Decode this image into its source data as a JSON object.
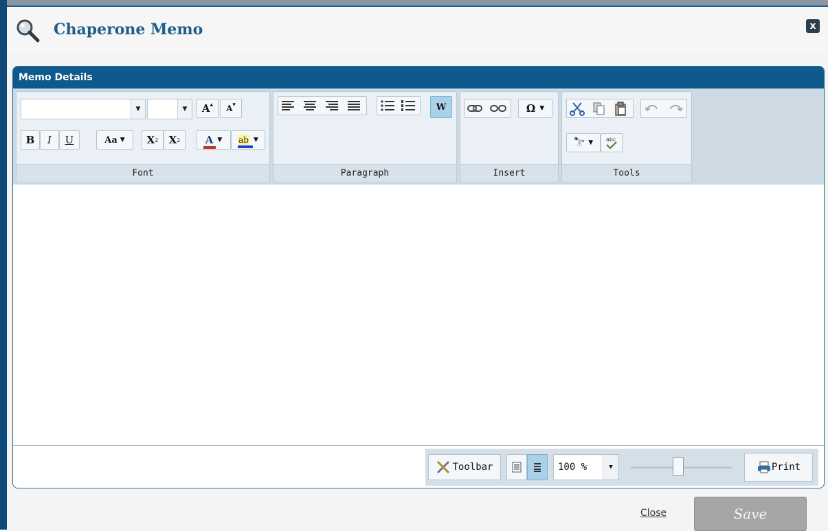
{
  "dialog": {
    "title": "Chaperone Memo",
    "close_symbol": "x"
  },
  "panel": {
    "header": "Memo Details"
  },
  "ribbon": {
    "font": {
      "label": "Font",
      "grow": "A",
      "shrink": "A",
      "bold": "B",
      "italic": "I",
      "underline": "U",
      "case": "Aa",
      "superscript": "X",
      "subscript": "X",
      "sup_mark": "2",
      "sub_mark": "2",
      "font_color": "A",
      "highlight": "ab"
    },
    "paragraph": {
      "label": "Paragraph",
      "word_label": "W"
    },
    "insert": {
      "label": "Insert",
      "symbol": "Ω"
    },
    "tools": {
      "label": "Tools"
    }
  },
  "statusbar": {
    "toolbar": "Toolbar",
    "zoom": "100 %",
    "zoom_level_percent": 100,
    "print": "Print"
  },
  "footer": {
    "close": "Close",
    "save": "Save"
  },
  "colors": {
    "accent": "#0e5a8d",
    "title": "#1d5f8a",
    "font_color_bar": "#c0392b",
    "highlight_bar": "#1d3fd9"
  }
}
